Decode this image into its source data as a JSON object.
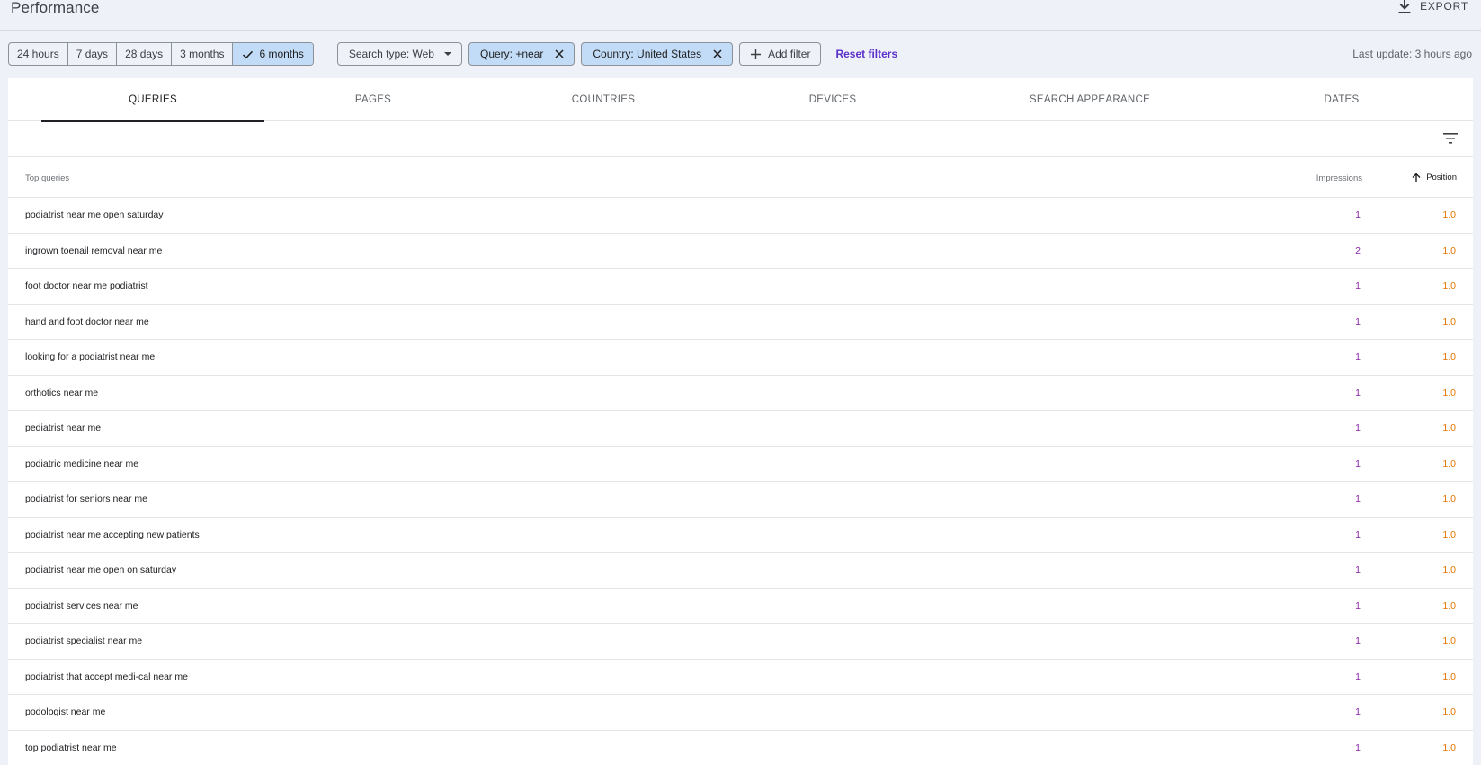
{
  "header": {
    "title": "Performance",
    "export_label": "EXPORT"
  },
  "date_ranges": [
    {
      "label": "24 hours",
      "active": false
    },
    {
      "label": "7 days",
      "active": false
    },
    {
      "label": "28 days",
      "active": false
    },
    {
      "label": "3 months",
      "active": false
    },
    {
      "label": "6 months",
      "active": true
    }
  ],
  "filters": {
    "search_type": "Search type: Web",
    "query": "Query: +near",
    "country": "Country: United States",
    "add_filter": "Add filter",
    "reset": "Reset filters"
  },
  "last_update": "Last update: 3 hours ago",
  "tabs": [
    {
      "label": "QUERIES",
      "active": true
    },
    {
      "label": "PAGES",
      "active": false
    },
    {
      "label": "COUNTRIES",
      "active": false
    },
    {
      "label": "DEVICES",
      "active": false
    },
    {
      "label": "SEARCH APPEARANCE",
      "active": false
    },
    {
      "label": "DATES",
      "active": false
    }
  ],
  "table": {
    "headers": {
      "query": "Top queries",
      "impressions": "Impressions",
      "position": "Position"
    },
    "rows": [
      {
        "query": "podiatrist near me open saturday",
        "impressions": "1",
        "position": "1.0"
      },
      {
        "query": "ingrown toenail removal near me",
        "impressions": "2",
        "position": "1.0"
      },
      {
        "query": "foot doctor near me podiatrist",
        "impressions": "1",
        "position": "1.0"
      },
      {
        "query": "hand and foot doctor near me",
        "impressions": "1",
        "position": "1.0"
      },
      {
        "query": "looking for a podiatrist near me",
        "impressions": "1",
        "position": "1.0"
      },
      {
        "query": "orthotics near me",
        "impressions": "1",
        "position": "1.0"
      },
      {
        "query": "pediatrist near me",
        "impressions": "1",
        "position": "1.0"
      },
      {
        "query": "podiatric medicine near me",
        "impressions": "1",
        "position": "1.0"
      },
      {
        "query": "podiatrist for seniors near me",
        "impressions": "1",
        "position": "1.0"
      },
      {
        "query": "podiatrist near me accepting new patients",
        "impressions": "1",
        "position": "1.0"
      },
      {
        "query": "podiatrist near me open on saturday",
        "impressions": "1",
        "position": "1.0"
      },
      {
        "query": "podiatrist services near me",
        "impressions": "1",
        "position": "1.0"
      },
      {
        "query": "podiatrist specialist near me",
        "impressions": "1",
        "position": "1.0"
      },
      {
        "query": "podiatrist that accept medi-cal near me",
        "impressions": "1",
        "position": "1.0"
      },
      {
        "query": "podologist near me",
        "impressions": "1",
        "position": "1.0"
      },
      {
        "query": "top podiatrist near me",
        "impressions": "1",
        "position": "1.0"
      }
    ]
  },
  "colors": {
    "impressions": "#8e24aa",
    "position": "#e37400",
    "active_chip": "#c2dcf7",
    "link": "#5b2fc9"
  }
}
